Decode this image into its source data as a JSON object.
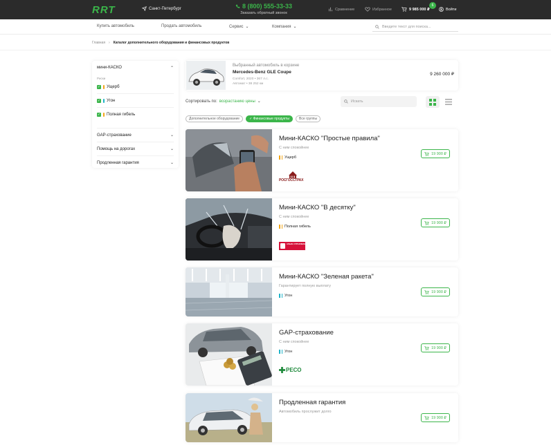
{
  "header": {
    "logo": "RRT",
    "city": "Санкт-Петербург",
    "phone": "8 (800) 555-33-33",
    "callback": "Заказать обратный звонок",
    "compare": "Сравнение",
    "favorites": "Избранное",
    "cart_price": "9 985 000 ₽",
    "cart_count": "6",
    "login": "Войти"
  },
  "nav": {
    "buy": "Купить автомобиль",
    "sell": "Продать автомобиль",
    "service": "Сервис",
    "company": "Компания",
    "search_placeholder": "Введите текст для поиска..."
  },
  "breadcrumb": {
    "home": "Главная",
    "current": "Каталог дополнительного оборудования и финансовых продуктов"
  },
  "sidebar": {
    "group_title": "мини-КАСКО",
    "risks_label": "Риски",
    "risks": [
      {
        "label": "Ущерб",
        "color": "#f2a516"
      },
      {
        "label": "Угон",
        "color": "#1fb3c8"
      },
      {
        "label": "Полная гибель",
        "color": "#f2a516"
      }
    ],
    "sections": [
      "GAP-страхование",
      "Помощь на дорогах",
      "Продленная гарантия"
    ]
  },
  "selected_car": {
    "caption": "Выбранный автомобиль в корзине",
    "model": "Mercedes-Benz GLE Coupe",
    "spec_line1": "Comfort, 2020  •  367 л.с.",
    "spec_line2": "Автомат  •  38 252 км",
    "price": "9 260 000 ₽"
  },
  "sort": {
    "label": "Сортировать по:",
    "value": "возрастанию цены",
    "search_placeholder": "Искать"
  },
  "chips": [
    {
      "label": "Дополнительное оборудование",
      "active": false
    },
    {
      "label": "Финансовые продукты",
      "active": true
    },
    {
      "label": "Все группы",
      "active": false
    }
  ],
  "products": [
    {
      "title": "Мини-КАСКО \"Простые правила\"",
      "subtitle": "С ним спокойнее",
      "tag": "Ущерб",
      "tag_color": "#f2a516",
      "logo": "РОСГОССТРАХ",
      "price": "19 900 ₽"
    },
    {
      "title": "Мини-КАСКО \"В десятку\"",
      "subtitle": "С ним спокойнее",
      "tag": "Полная гибель",
      "tag_color": "#f2a516",
      "logo": "АЛЬФА СТРАХОВАНИЕ",
      "price": "19 900 ₽"
    },
    {
      "title": "Мини-КАСКО \"Зеленая ракета\"",
      "subtitle": "Гарантирует полную выплату",
      "tag": "Угон",
      "tag_color": "#1fb3c8",
      "logo": "",
      "price": "19 900 ₽"
    },
    {
      "title": "GAP-страхование",
      "subtitle": "С ним спокойнее",
      "tag": "Угон",
      "tag_color": "#1fb3c8",
      "logo": "РЕСО",
      "price": "19 900 ₽"
    },
    {
      "title": "Продленная гарантия",
      "subtitle": "Автомобиль прослужит долго",
      "tag": "",
      "tag_color": "",
      "logo": "",
      "price": "19 900 ₽"
    }
  ],
  "colors": {
    "accent": "#3bb54a",
    "header_bg": "#2b2b2b"
  }
}
